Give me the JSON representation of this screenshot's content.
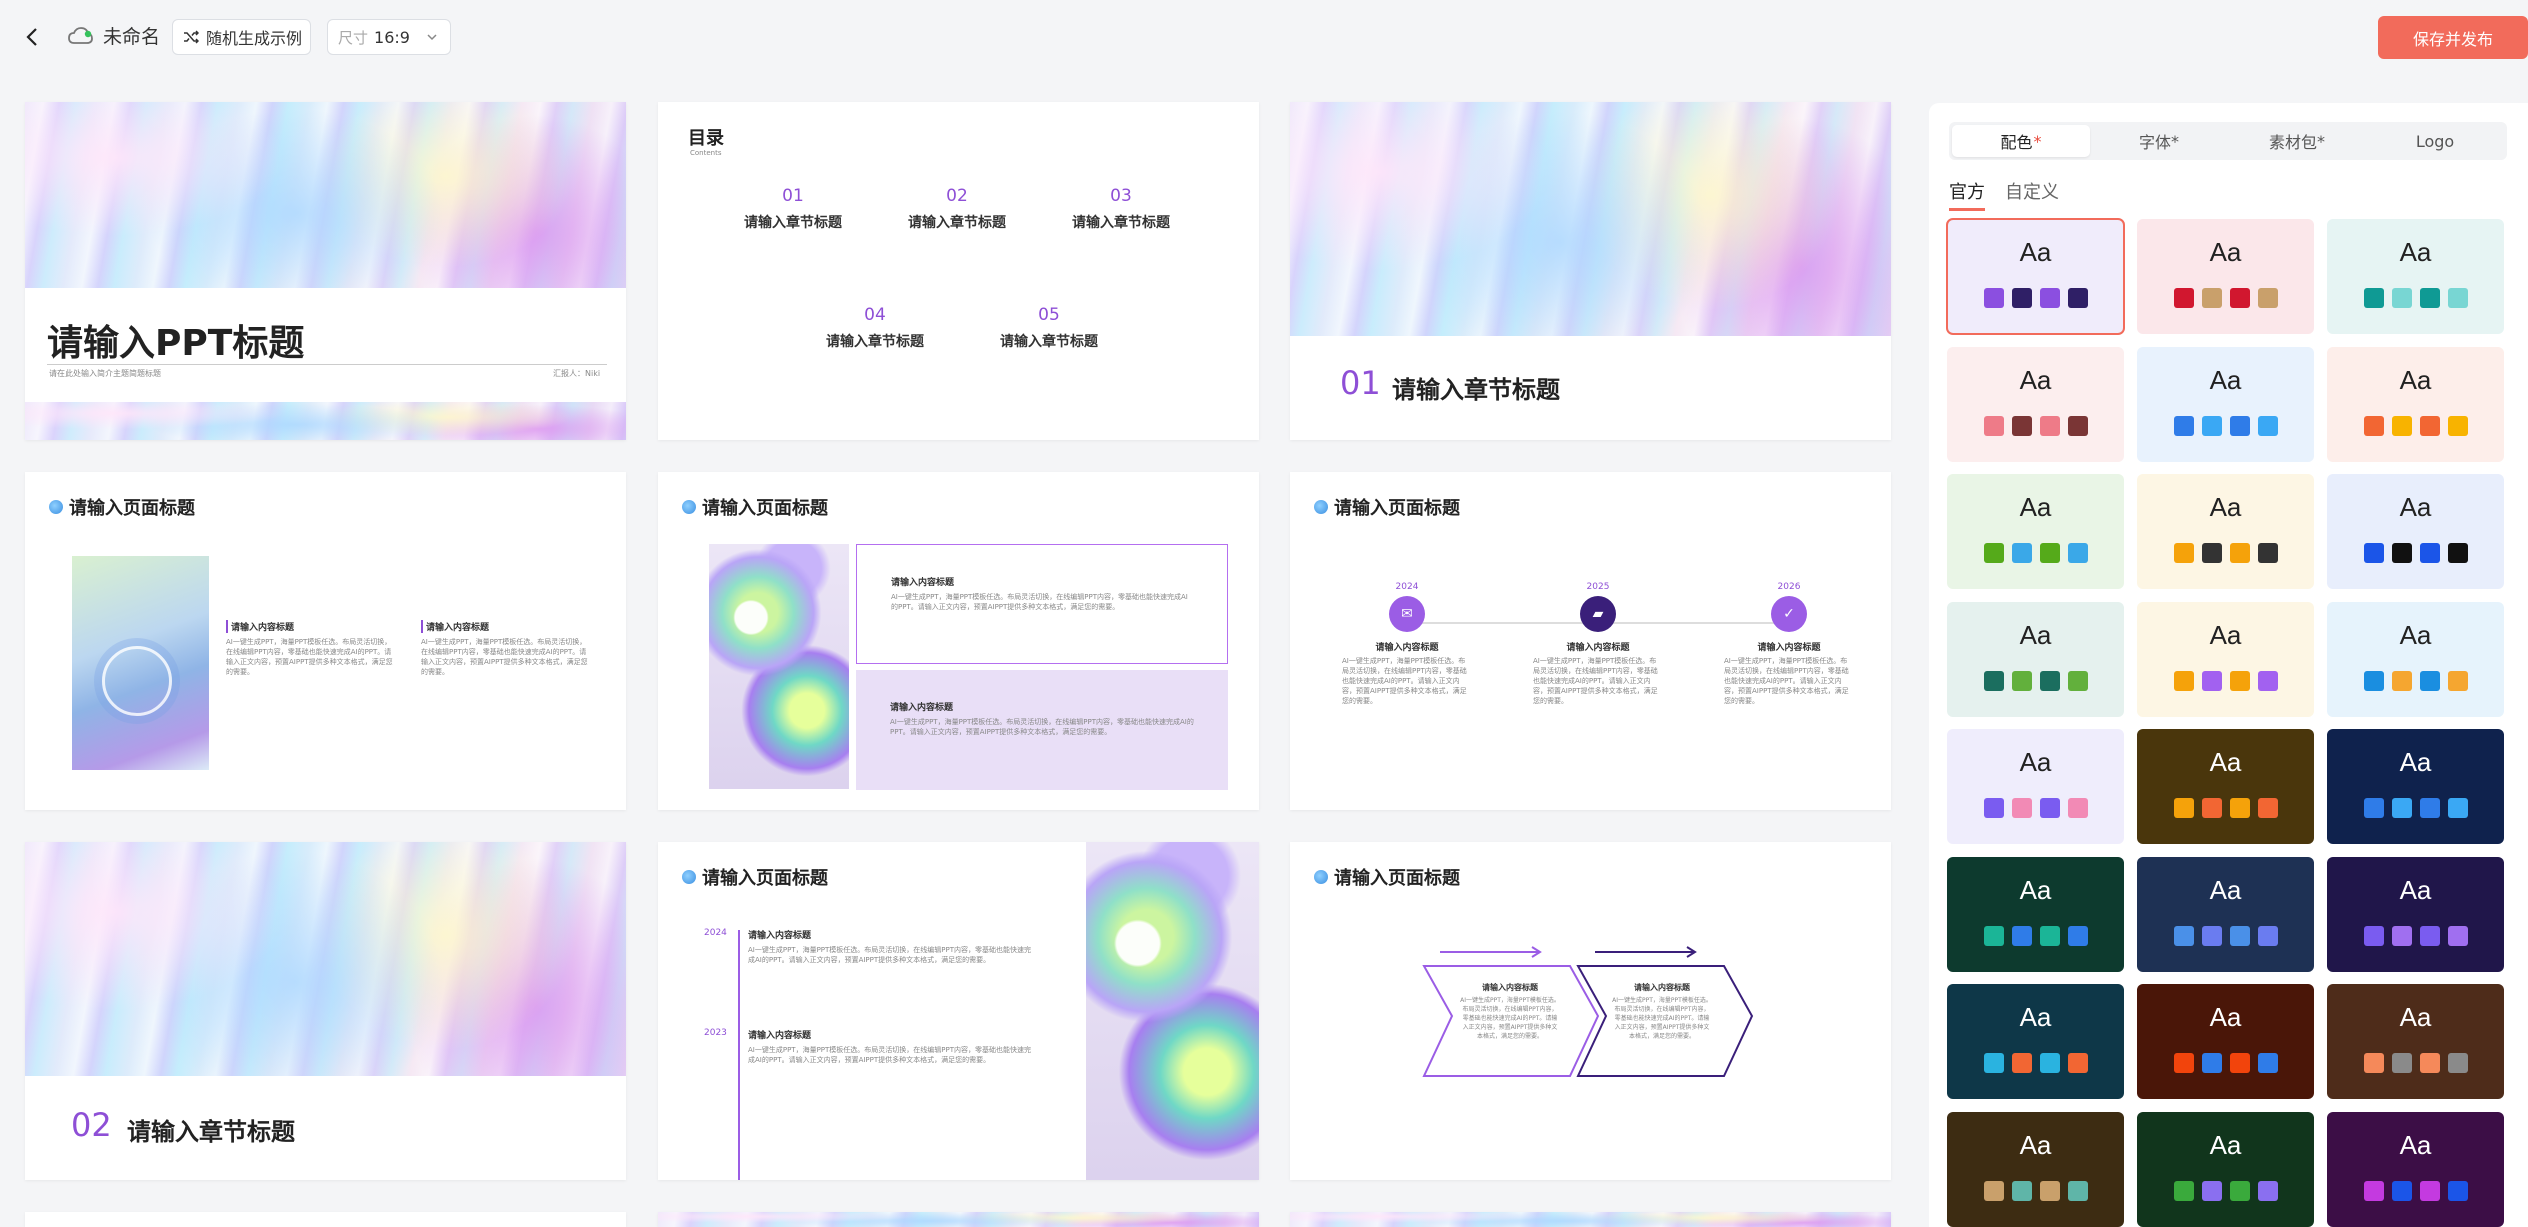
{
  "topbar": {
    "doc_name": "未命名",
    "random_label": "随机生成示例",
    "size_label": "尺寸",
    "size_value": "16:9",
    "publish_label": "保存并发布"
  },
  "slides": {
    "cover": {
      "title": "请输入PPT标题",
      "subtitle": "请在此处输入简介主题简题标题",
      "reporter": "汇报人：Niki"
    },
    "toc": {
      "title": "目录",
      "title_en": "Contents",
      "items": [
        {
          "num": "01",
          "label": "请输入章节标题"
        },
        {
          "num": "02",
          "label": "请输入章节标题"
        },
        {
          "num": "03",
          "label": "请输入章节标题"
        },
        {
          "num": "04",
          "label": "请输入章节标题"
        },
        {
          "num": "05",
          "label": "请输入章节标题"
        }
      ]
    },
    "chapter1": {
      "num": "01",
      "title": "请输入章节标题"
    },
    "page1": {
      "title": "请输入页面标题",
      "col_heading": "请输入内容标题",
      "col_body": "AI一键生成PPT，海量PPT模板任选。布局灵活切换，在线编辑PPT内容，零基础也能快速完成AI的PPT。请输入正文内容，预置AIPPT提供多种文本格式，满足您的需要。"
    },
    "page2": {
      "title": "请输入页面标题",
      "heading": "请输入内容标题",
      "body": "AI一键生成PPT，海量PPT模板任选。布局灵活切换，在线编辑PPT内容，零基础也能快速完成AI的PPT。请输入正文内容，预置AIPPT提供多种文本格式，满足您的需要。"
    },
    "page3": {
      "title": "请输入页面标题",
      "years": [
        "2024",
        "2025",
        "2026"
      ],
      "heading": "请输入内容标题",
      "body": "AI一键生成PPT，海量PPT模板任选。布局灵活切换，在线编辑PPT内容，零基础也能快速完成AI的PPT。请输入正文内容，预置AIPPT提供多种文本格式，满足您的需要。"
    },
    "chapter2": {
      "num": "02",
      "title": "请输入章节标题"
    },
    "page4": {
      "title": "请输入页面标题",
      "years": [
        "2024",
        "2023"
      ],
      "heading": "请输入内容标题",
      "body": "AI一键生成PPT，海量PPT模板任选。布局灵活切换，在线编辑PPT内容，零基础也能快速完成AI的PPT。请输入正文内容，预置AIPPT提供多种文本格式，满足您的需要。"
    },
    "page5": {
      "title": "请输入页面标题",
      "heading": "请输入内容标题",
      "body": "AI一键生成PPT，海量PPT模板任选。布局灵活切换，在线编辑PPT内容，零基础也能快速完成AI的PPT。请输入正文内容，预置AIPPT提供多种文本格式，满足您的需要。"
    }
  },
  "panel": {
    "tabs": [
      {
        "label": "配色",
        "star": "*"
      },
      {
        "label": "字体",
        "star": "*"
      },
      {
        "label": "素材包",
        "star": "*"
      },
      {
        "label": "Logo",
        "star": ""
      }
    ],
    "subtabs": [
      "官方",
      "自定义"
    ],
    "aa": "Aa",
    "schemes": [
      {
        "bg": "#f0ecfb",
        "text": "#222",
        "colors": [
          "#8b4fe0",
          "#2f1f66",
          "#8b4fe0",
          "#2f1f66"
        ]
      },
      {
        "bg": "#fbe7ea",
        "text": "#222",
        "colors": [
          "#d1172f",
          "#c9a06b",
          "#d1172f",
          "#c9a06b"
        ]
      },
      {
        "bg": "#e6f4f3",
        "text": "#222",
        "colors": [
          "#0f9a94",
          "#78d6d3",
          "#0f9a94",
          "#78d6d3"
        ]
      },
      {
        "bg": "#fceeee",
        "text": "#222",
        "colors": [
          "#ee7b88",
          "#7a3535",
          "#ee7b88",
          "#7a3535"
        ]
      },
      {
        "bg": "#e8f2fd",
        "text": "#222",
        "colors": [
          "#2f7ce8",
          "#3aa8f4",
          "#2f7ce8",
          "#3aa8f4"
        ]
      },
      {
        "bg": "#fdeeea",
        "text": "#222",
        "colors": [
          "#f26633",
          "#f8b300",
          "#f26633",
          "#f8b300"
        ]
      },
      {
        "bg": "#e9f5e6",
        "text": "#222",
        "colors": [
          "#55aa1a",
          "#3aa8e8",
          "#55aa1a",
          "#3aa8e8"
        ]
      },
      {
        "bg": "#fdf6e4",
        "text": "#222",
        "colors": [
          "#f5a20a",
          "#333333",
          "#f5a20a",
          "#333333"
        ]
      },
      {
        "bg": "#e8eefc",
        "text": "#222",
        "colors": [
          "#1b55e8",
          "#111111",
          "#1b55e8",
          "#111111"
        ]
      },
      {
        "bg": "#e5f1ee",
        "text": "#222",
        "colors": [
          "#1b6e5f",
          "#62b03c",
          "#1b6e5f",
          "#62b03c"
        ]
      },
      {
        "bg": "#fdf6e4",
        "text": "#222",
        "colors": [
          "#f5a20a",
          "#a261f0",
          "#f5a20a",
          "#a261f0"
        ]
      },
      {
        "bg": "#e6f3fc",
        "text": "#222",
        "colors": [
          "#1a8ee0",
          "#f5a630",
          "#1a8ee0",
          "#f5a630"
        ]
      },
      {
        "bg": "#efedfc",
        "text": "#222",
        "colors": [
          "#7a5cf0",
          "#f28ab5",
          "#7a5cf0",
          "#f28ab5"
        ]
      },
      {
        "bg": "#4a360c",
        "text": "#fff",
        "colors": [
          "#f5a20a",
          "#f26633",
          "#f5a20a",
          "#f26633"
        ]
      },
      {
        "bg": "#0f224d",
        "text": "#fff",
        "colors": [
          "#2f7ce8",
          "#3aa8f4",
          "#2f7ce8",
          "#3aa8f4"
        ]
      },
      {
        "bg": "#0d3a2e",
        "text": "#fff",
        "colors": [
          "#1bb597",
          "#2f7ce8",
          "#1bb597",
          "#2f7ce8"
        ]
      },
      {
        "bg": "#1e3154",
        "text": "#fff",
        "colors": [
          "#4a90e8",
          "#6a7cf0",
          "#4a90e8",
          "#6a7cf0"
        ]
      },
      {
        "bg": "#20164a",
        "text": "#fff",
        "colors": [
          "#7a5cf0",
          "#a06ff0",
          "#7a5cf0",
          "#a06ff0"
        ]
      },
      {
        "bg": "#0e3748",
        "text": "#fff",
        "colors": [
          "#2ab3e0",
          "#f26633",
          "#2ab3e0",
          "#f26633"
        ]
      },
      {
        "bg": "#4a1608",
        "text": "#fff",
        "colors": [
          "#f2440c",
          "#2f7ce8",
          "#f2440c",
          "#2f7ce8"
        ]
      },
      {
        "bg": "#4e2c1a",
        "text": "#fff",
        "colors": [
          "#f5895a",
          "#8a8a8a",
          "#f5895a",
          "#8a8a8a"
        ]
      },
      {
        "bg": "#3d2c12",
        "text": "#fff",
        "colors": [
          "#c9a06b",
          "#5fb5a8",
          "#c9a06b",
          "#5fb5a8"
        ]
      },
      {
        "bg": "#11351c",
        "text": "#fff",
        "colors": [
          "#3aaa3c",
          "#8a6ff0",
          "#3aaa3c",
          "#8a6ff0"
        ]
      },
      {
        "bg": "#3c0e46",
        "text": "#fff",
        "colors": [
          "#c43ae0",
          "#1b55e8",
          "#c43ae0",
          "#1b55e8"
        ]
      }
    ]
  }
}
